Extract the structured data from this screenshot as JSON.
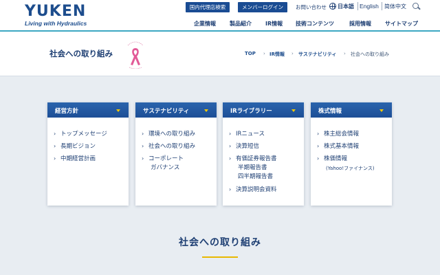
{
  "header": {
    "logo_main": "YUKEN",
    "logo_sub": "Living with Hydraulics",
    "dealer_button": "国内代理店検索",
    "member_button": "メンバーログイン",
    "contact_link": "お問い合わせ",
    "languages": [
      "日本語",
      "English",
      "简体中文"
    ],
    "nav": [
      "企業情報",
      "製品紹介",
      "IR情報",
      "技術コンテンツ",
      "採用情報",
      "サイトマップ"
    ]
  },
  "title_band": {
    "page_title": "社会への取り組み",
    "breadcrumb": [
      "TOP",
      "IR情報",
      "サステナビリティ",
      "社会への取り組み"
    ],
    "breadcrumb_separator": "›"
  },
  "cards": [
    {
      "title": "経営方針",
      "items": [
        "トップメッセージ",
        "長期ビジョン",
        "中期経営計画"
      ]
    },
    {
      "title": "サステナビリティ",
      "items": [
        "環境への取り組み",
        "社会への取り組み",
        "コーポレート",
        "ガバナンス"
      ]
    },
    {
      "title": "IRライブラリー",
      "items": [
        "IRニュース",
        "決算短信",
        "有価証券報告書",
        "半期報告書",
        "四半期報告書",
        "決算説明会資料"
      ]
    },
    {
      "title": "株式情報",
      "items": [
        "株主総会情報",
        "株式基本情報",
        "株価情報",
        "(Yahoo!ファイナンス)"
      ]
    }
  ],
  "section": {
    "title": "社会への取り組み"
  },
  "colors": {
    "brand_blue": "#1d4d8d",
    "card_header": "#2a63ad",
    "accent_yellow": "#f3c800",
    "header_rule": "#3ca7c2",
    "page_bg": "#e8edf2"
  }
}
